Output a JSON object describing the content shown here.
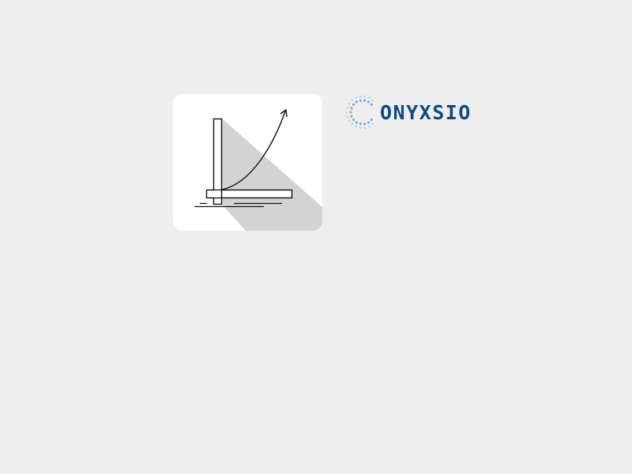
{
  "icon": {
    "name": "growth-chart-icon",
    "tile_color": "#ffffff",
    "shadow_color": "#d3d3d3",
    "stroke_color": "#111111"
  },
  "brand": {
    "logo_name": "onyxsio-logo",
    "wordmark": "ONYXSIO",
    "wordmark_color": "#0e4a7e",
    "ring_color": "#6fa8dc",
    "ring_light_color": "#b7d3ee"
  }
}
